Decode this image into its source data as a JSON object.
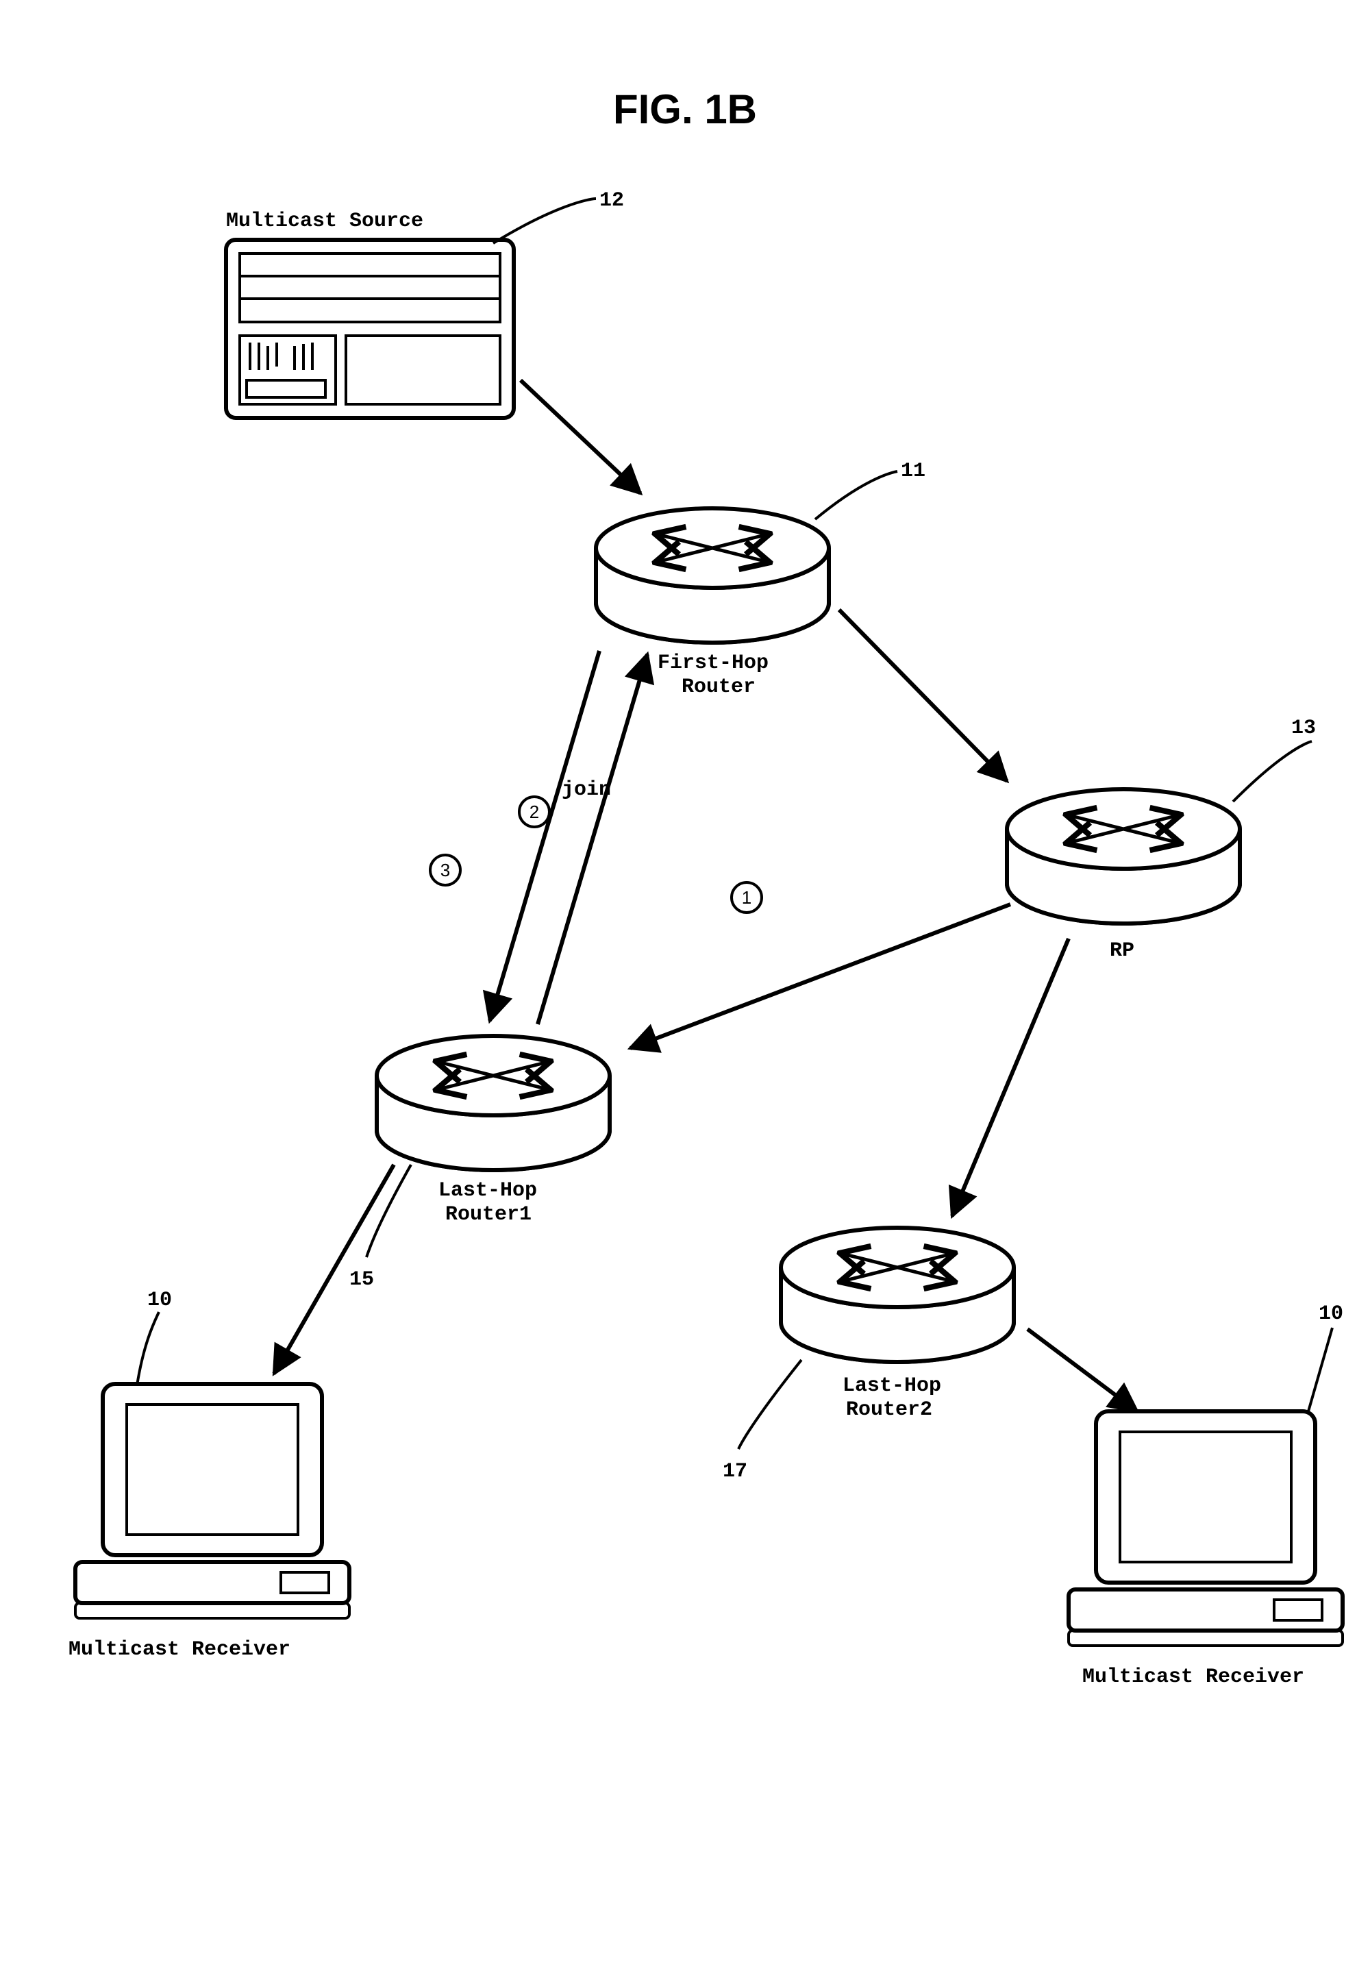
{
  "figure": {
    "title": "FIG. 1B",
    "nodes": {
      "source": {
        "label_l1": "Multicast Source",
        "ref": "12"
      },
      "firsthop": {
        "label_l1": "First-Hop",
        "label_l2": "Router",
        "ref": "11"
      },
      "rp": {
        "label_l1": "RP",
        "ref": "13"
      },
      "lasthop1": {
        "label_l1": "Last-Hop",
        "label_l2": "Router1",
        "ref": "15"
      },
      "lasthop2": {
        "label_l1": "Last-Hop",
        "label_l2": "Router2",
        "ref": "17"
      },
      "recv1": {
        "label_l1": "Multicast Receiver",
        "ref": "10"
      },
      "recv2": {
        "label_l1": "Multicast Receiver",
        "ref": "10"
      }
    },
    "edges": {
      "step1": "1",
      "step2": "2",
      "step3": "3",
      "join": "join"
    }
  }
}
